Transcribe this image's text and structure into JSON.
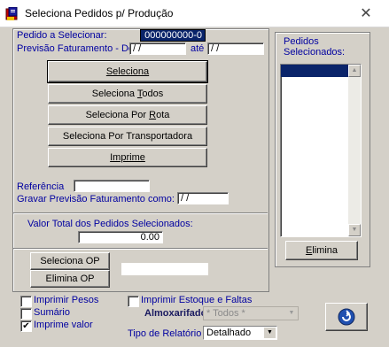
{
  "window": {
    "title": "Seleciona Pedidos p/ Produção",
    "close_glyph": "✕"
  },
  "top": {
    "pedido_label": "Pedido a Selecionar:",
    "pedido_value": "000000000-0",
    "previsao_label": "Previsão Faturamento - De",
    "date_from": " / /",
    "ate_label": "até",
    "date_to": " / /"
  },
  "buttons": {
    "seleciona": "Seleciona",
    "seleciona_todos_prefix": "Seleciona ",
    "seleciona_todos_key": "T",
    "seleciona_todos_suffix": "odos",
    "seleciona_rota_prefix": "Seleciona Por ",
    "seleciona_rota_key": "R",
    "seleciona_rota_suffix": "ota",
    "seleciona_transportadora": "Seleciona Por Transportadora",
    "imprime": "Imprime"
  },
  "referencia": {
    "label": "Referência",
    "value": "",
    "gravar_label": "Gravar Previsão Faturamento como:",
    "gravar_value": " / /"
  },
  "total": {
    "label": "Valor Total dos Pedidos Selecionados:",
    "value": "0.00"
  },
  "op": {
    "seleciona_op": "Seleciona OP",
    "elimina_op": "Elimina OP",
    "op_value": ""
  },
  "right_panel": {
    "title": "Pedidos Selecionados:",
    "elimina_prefix": "",
    "elimina_key": "E",
    "elimina_suffix": "limina"
  },
  "bottom": {
    "imprimir_pesos": "Imprimir Pesos",
    "imprimir_pesos_checked": false,
    "sumario": "Sumário",
    "sumario_checked": false,
    "imprime_valor": "Imprime valor",
    "imprime_valor_checked": true,
    "imprimir_estoque": "Imprimir Estoque e Faltas",
    "imprimir_estoque_checked": false,
    "almoxarifado_label": "Almoxarifado",
    "almoxarifado_value": "* Todos *",
    "tipo_label": "Tipo de Relatório",
    "tipo_value": "Detalhado"
  },
  "icons": {
    "app": "app-icon",
    "exit": "exit-icon"
  },
  "colors": {
    "face": "#d4d0c8",
    "label_blue": "#0000a0",
    "selection": "#0a246a"
  }
}
